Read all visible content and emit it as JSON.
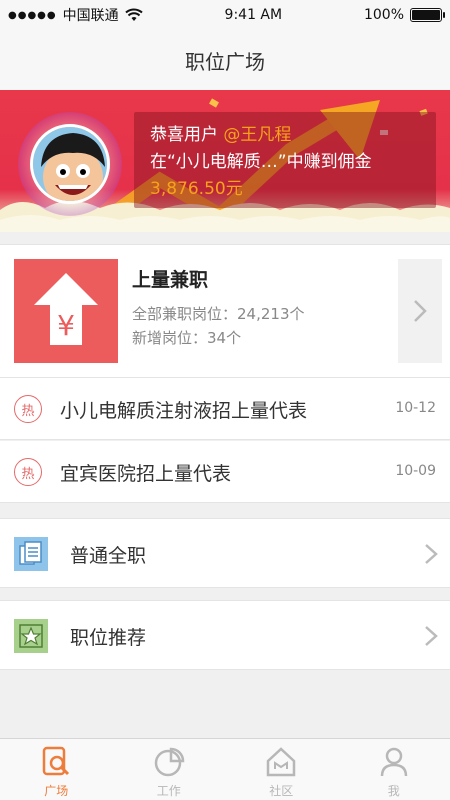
{
  "status_bar": {
    "carrier": "中国联通",
    "time": "9:41 AM",
    "battery": "100%"
  },
  "nav": {
    "title": "职位广场"
  },
  "banner": {
    "line1_prefix": "恭喜用户",
    "line1_user": "@王凡程",
    "line2": "在“小儿电解质…”中赚到佣金",
    "line3_amount": "3,876.50元"
  },
  "promo": {
    "title": "上量兼职",
    "line1": "全部兼职岗位：24,213个",
    "line2": "新增岗位：34个"
  },
  "hot_list": [
    {
      "badge": "热",
      "text": "小儿电解质注射液招上量代表",
      "date": "10-12"
    },
    {
      "badge": "热",
      "text": "宜宾医院招上量代表",
      "date": "10-09"
    }
  ],
  "menu": [
    {
      "label": "普通全职",
      "icon": "document-icon"
    },
    {
      "label": "职位推荐",
      "icon": "star-badge-icon"
    }
  ],
  "tabs": [
    {
      "label": "广场",
      "icon": "search-doc-icon",
      "active": true
    },
    {
      "label": "工作",
      "icon": "pie-chart-icon",
      "active": false
    },
    {
      "label": "社区",
      "icon": "home-icon",
      "active": false
    },
    {
      "label": "我",
      "icon": "person-icon",
      "active": false
    }
  ],
  "colors": {
    "brand_red": "#e8384a",
    "accent_orange": "#f7a21b",
    "tab_active": "#ee7c3a",
    "hot_red": "#e56a6a"
  }
}
